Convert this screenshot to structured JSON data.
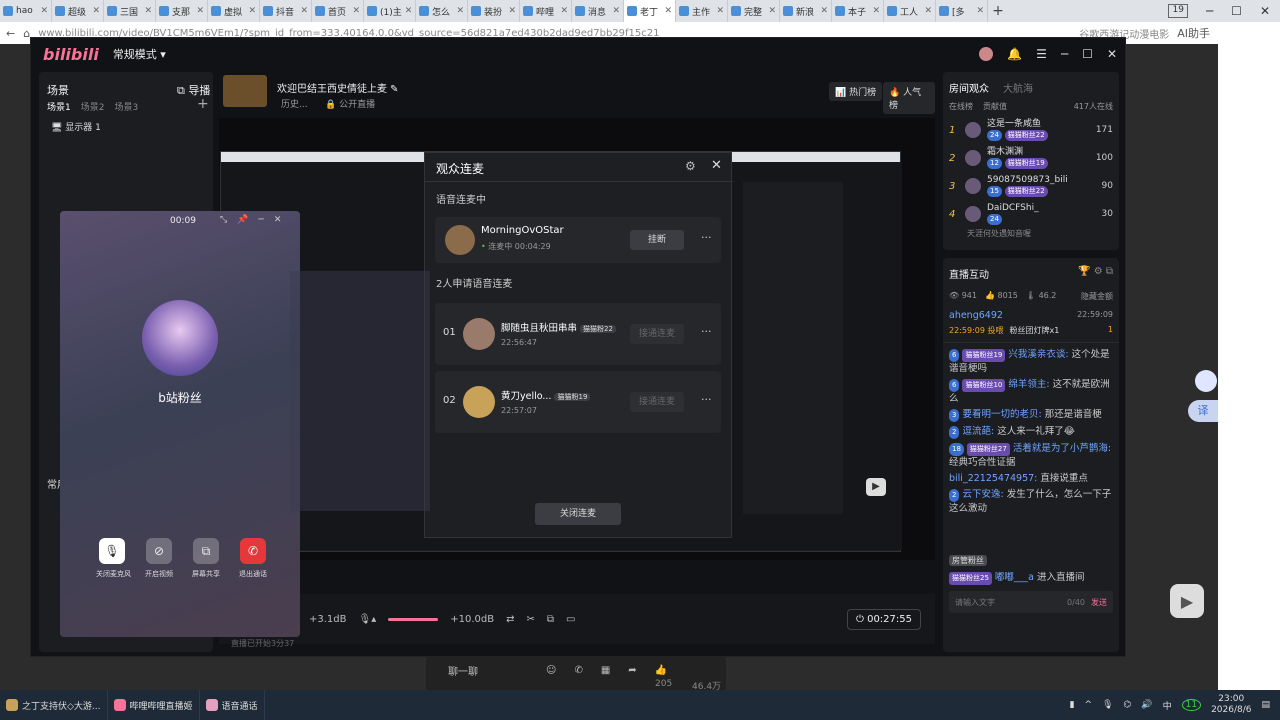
{
  "browser": {
    "tabs": [
      "hao",
      "超级",
      "三国",
      "支那",
      "虚拟",
      "抖音",
      "首页",
      "(1)主",
      "怎么",
      "装扮",
      "哔哩",
      "消息",
      "老丁",
      "主作",
      "完整",
      "新浪",
      "本子",
      "工人",
      "[多"
    ],
    "active_tab_index": 12,
    "url": "www.bilibili.com/video/BV1CM5m6VEm1/?spm_id_from=333.40164.0.0&vd_source=56d821a7ed430b2dad9ed7bb29f15c21",
    "search_hint": "谷歌西游记动漫电影",
    "ai_label": "AI助手",
    "tab_count": "19"
  },
  "app": {
    "logo": "bilibili",
    "mode": "常规模式",
    "scene_panel": {
      "title": "场景",
      "guide": "导播",
      "scenes": [
        "场景1",
        "场景2",
        "场景3"
      ],
      "source": "显示器 1",
      "common_label": "常用"
    },
    "stream": {
      "title": "欢迎巴结王西史倩徒上麦",
      "category": "历史...",
      "visibility": "公开直播",
      "hot_rank": "热门榜",
      "pop_rank": "人气榜"
    },
    "controls": {
      "vol_left": "+3.1dB",
      "vol_right": "+10.0dB",
      "timer": "00:27:55",
      "status": "直播已开始3分37"
    },
    "audience": {
      "tab_active": "房间观众",
      "tab_other": "大航海",
      "filter1": "在线榜",
      "filter2": "贡献值",
      "online": "417人在线",
      "ranks": [
        {
          "num": "1",
          "name": "这是一条咸鱼",
          "lv": "24",
          "fan": "猫猫粉丝22",
          "score": "171"
        },
        {
          "num": "2",
          "name": "霜木渊渊",
          "lv": "12",
          "fan": "猫猫粉丝19",
          "score": "100"
        },
        {
          "num": "3",
          "name": "59087509873_bili",
          "lv": "15",
          "fan": "猫猫粉丝22",
          "score": "90"
        },
        {
          "num": "4",
          "name": "DaiDCFShi_",
          "lv": "24",
          "fan": "",
          "score": "30"
        }
      ],
      "more": "天涯何处遇知音喔"
    },
    "interact": {
      "title": "直播互动",
      "views": "941",
      "likes": "8015",
      "temp": "46.2",
      "hide": "隐藏金额",
      "gift_user": "aheng6492",
      "gift_time": "22:59:09",
      "gift_line": "22:59:09 投喂",
      "gift_name": "粉丝团灯牌x1",
      "gift_count": "1",
      "messages": [
        {
          "lv": "6",
          "fan": "猫猫粉丝19",
          "user": "兴我溪亲衣谈:",
          "text": "这个处是谐音梗吗"
        },
        {
          "lv": "6",
          "fan": "猫猫粉丝10",
          "user": "绵羊领主:",
          "text": "这不就是欧洲么"
        },
        {
          "lv": "3",
          "fan": "",
          "user": "要看明一切的老贝:",
          "text": "那还是谐音梗"
        },
        {
          "lv": "2",
          "fan": "",
          "user": "逗流葩:",
          "text": "这人来一礼拜了😂"
        },
        {
          "lv": "18",
          "fan": "猫猫粉丝27",
          "user": "活着就是为了小芦鹊海:",
          "text": "经典巧合性证据"
        },
        {
          "lv": "",
          "fan": "",
          "user": "bili_22125474957:",
          "text": "直接说重点"
        },
        {
          "lv": "2",
          "fan": "",
          "user": "云下安逸:",
          "text": "发生了什么，怎么一下子这么激动"
        }
      ],
      "system_tag": "房管粉丝",
      "enter_fan": "猫猫粉丝25",
      "enter_user": "嘟嘟___a",
      "enter_text": "进入直播间",
      "input_placeholder": "请输入文字",
      "input_count": "0/40",
      "send": "发送"
    }
  },
  "dialog": {
    "title": "观众连麦",
    "section_live": "语音连麦中",
    "live_user": "MorningOvOStar",
    "live_status": "连麦中 00:04:29",
    "hangup": "挂断",
    "section_apply": "2人申请语音连麦",
    "applicants": [
      {
        "idx": "01",
        "name": "脚随虫且秋田串串",
        "badge": "猫猫粉22",
        "time": "22:56:47",
        "btn": "接通连麦"
      },
      {
        "idx": "02",
        "name": "黄刀yello...",
        "badge": "猫猫粉19",
        "time": "22:57:07",
        "btn": "接通连麦"
      }
    ],
    "close_btn": "关闭连麦"
  },
  "call": {
    "time": "00:09",
    "name": "b站粉丝",
    "buttons": [
      "关闭麦克风",
      "开启视频",
      "屏幕共享",
      "退出通话"
    ]
  },
  "bg_video": {
    "chat_placeholder": "聊一聊",
    "count1": "205",
    "count2": "46.4万"
  },
  "taskbar": {
    "items": [
      "之丁支持伏◇大游...",
      "哔哩哔哩直播姬",
      "语音通话"
    ],
    "time": "23:00",
    "date": "2026/8/6",
    "ime": "中",
    "badge": "11"
  }
}
